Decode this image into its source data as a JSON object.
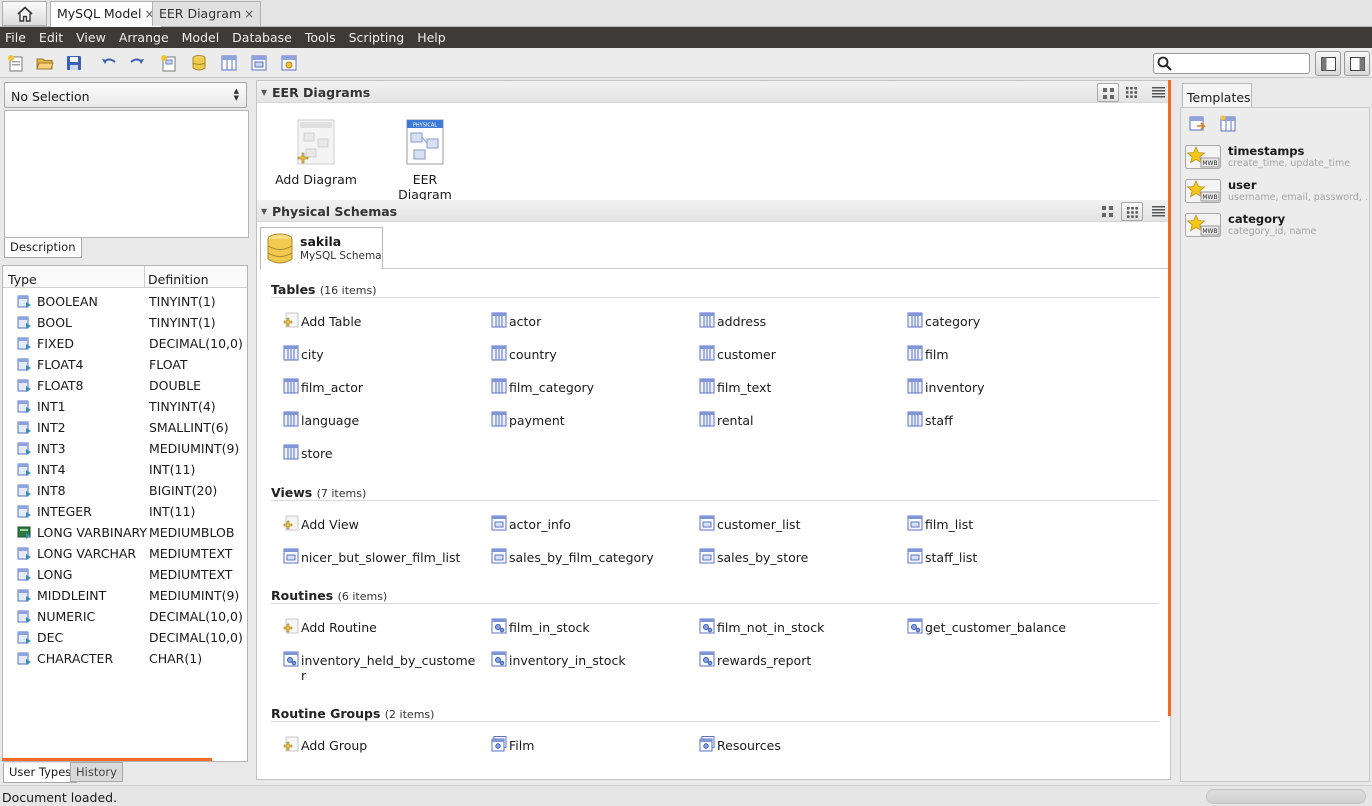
{
  "tabs": {
    "home_icon": "home-icon",
    "items": [
      {
        "label": "MySQL Model",
        "close": "×"
      },
      {
        "label": "EER Diagram",
        "close": "×"
      }
    ]
  },
  "menu": [
    "File",
    "Edit",
    "View",
    "Arrange",
    "Model",
    "Database",
    "Tools",
    "Scripting",
    "Help"
  ],
  "toolbar": {
    "search_placeholder": ""
  },
  "left": {
    "selection": "No Selection",
    "description_tab": "Description",
    "types_header": {
      "type": "Type",
      "definition": "Definition"
    },
    "types": [
      {
        "name": "BOOLEAN",
        "def": "TINYINT(1)"
      },
      {
        "name": "BOOL",
        "def": "TINYINT(1)"
      },
      {
        "name": "FIXED",
        "def": "DECIMAL(10,0)"
      },
      {
        "name": "FLOAT4",
        "def": "FLOAT"
      },
      {
        "name": "FLOAT8",
        "def": "DOUBLE"
      },
      {
        "name": "INT1",
        "def": "TINYINT(4)"
      },
      {
        "name": "INT2",
        "def": "SMALLINT(6)"
      },
      {
        "name": "INT3",
        "def": "MEDIUMINT(9)"
      },
      {
        "name": "INT4",
        "def": "INT(11)"
      },
      {
        "name": "INT8",
        "def": "BIGINT(20)"
      },
      {
        "name": "INTEGER",
        "def": "INT(11)"
      },
      {
        "name": "LONG VARBINARY",
        "def": "MEDIUMBLOB"
      },
      {
        "name": "LONG VARCHAR",
        "def": "MEDIUMTEXT"
      },
      {
        "name": "LONG",
        "def": "MEDIUMTEXT"
      },
      {
        "name": "MIDDLEINT",
        "def": "MEDIUMINT(9)"
      },
      {
        "name": "NUMERIC",
        "def": "DECIMAL(10,0)"
      },
      {
        "name": "DEC",
        "def": "DECIMAL(10,0)"
      },
      {
        "name": "CHARACTER",
        "def": "CHAR(1)"
      }
    ],
    "bottom_tabs": [
      "User Types",
      "History"
    ]
  },
  "center": {
    "eer_title": "EER Diagrams",
    "diagrams": [
      {
        "label": "Add Diagram",
        "badge": "PHYSICAL"
      },
      {
        "label": "EER Diagram",
        "badge": "PHYSICAL"
      }
    ],
    "physical_title": "Physical Schemas",
    "schema": {
      "name": "sakila",
      "type": "MySQL Schema"
    },
    "categories": [
      {
        "title": "Tables",
        "count": "(16 items)",
        "items": [
          "Add Table",
          "actor",
          "address",
          "category",
          "city",
          "country",
          "customer",
          "film",
          "film_actor",
          "film_category",
          "film_text",
          "inventory",
          "language",
          "payment",
          "rental",
          "staff",
          "store"
        ]
      },
      {
        "title": "Views",
        "count": "(7 items)",
        "items": [
          "Add View",
          "actor_info",
          "customer_list",
          "film_list",
          "nicer_but_slower_film_list",
          "sales_by_film_category",
          "sales_by_store",
          "staff_list"
        ]
      },
      {
        "title": "Routines",
        "count": "(6 items)",
        "items": [
          "Add Routine",
          "film_in_stock",
          "film_not_in_stock",
          "get_customer_balance",
          "inventory_held_by_custome",
          "inventory_in_stock",
          "rewards_report"
        ],
        "wrap_suffix": "r"
      },
      {
        "title": "Routine Groups",
        "count": "(2 items)",
        "items": [
          "Add Group",
          "Film",
          "Resources"
        ]
      }
    ]
  },
  "right": {
    "tab": "Templates",
    "templates": [
      {
        "name": "timestamps",
        "desc": "create_time, update_time",
        "badge": "MWB"
      },
      {
        "name": "user",
        "desc": "username, email, password, ...",
        "badge": "MWB"
      },
      {
        "name": "category",
        "desc": "category_id, name",
        "badge": "MWB"
      }
    ]
  },
  "status": {
    "message": "Document loaded."
  },
  "colors": {
    "accent": "#f06a2a",
    "menubar": "#3c3b37",
    "table_icon": "#5a72c8"
  }
}
